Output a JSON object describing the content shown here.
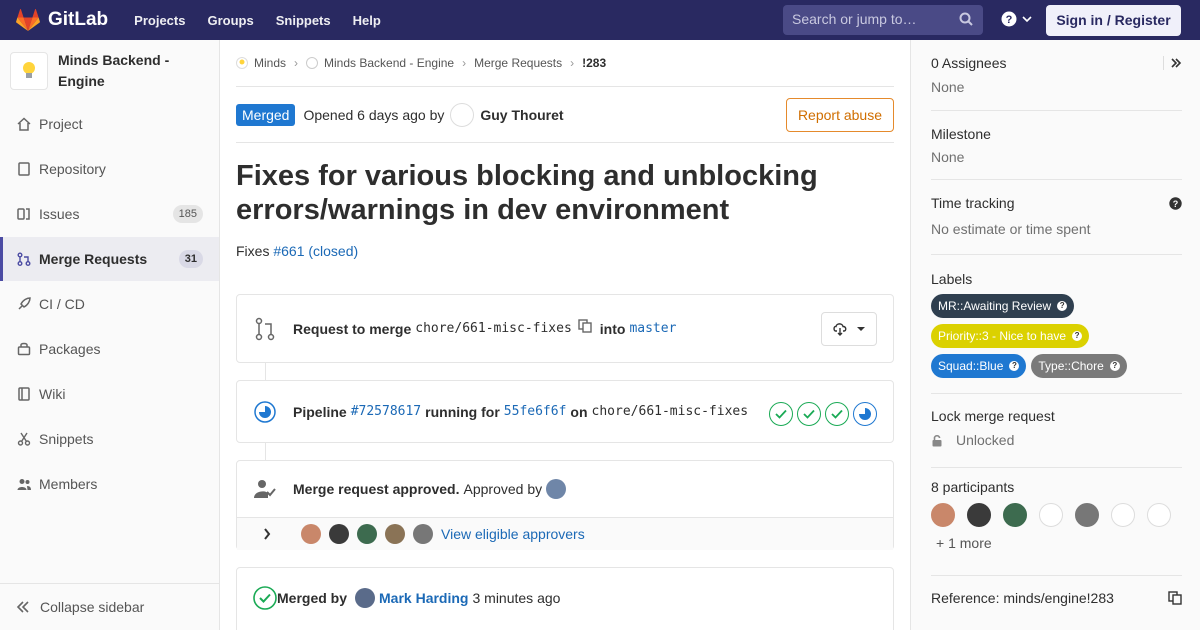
{
  "navbar": {
    "brand": "GitLab",
    "links": [
      "Projects",
      "Groups",
      "Snippets",
      "Help"
    ],
    "search_placeholder": "Search or jump to…",
    "signin_label": "Sign in / Register"
  },
  "sidebar": {
    "project_name": "Minds Backend - Engine",
    "items": [
      {
        "label": "Project",
        "icon": "home-icon"
      },
      {
        "label": "Repository",
        "icon": "doc-icon"
      },
      {
        "label": "Issues",
        "icon": "issues-icon",
        "count": "185"
      },
      {
        "label": "Merge Requests",
        "icon": "merge-request-icon",
        "count": "31",
        "active": true
      },
      {
        "label": "CI / CD",
        "icon": "rocket-icon"
      },
      {
        "label": "Packages",
        "icon": "package-icon"
      },
      {
        "label": "Wiki",
        "icon": "book-icon"
      },
      {
        "label": "Snippets",
        "icon": "scissors-icon"
      },
      {
        "label": "Members",
        "icon": "users-icon"
      }
    ],
    "collapse_label": "Collapse sidebar"
  },
  "breadcrumb": [
    "Minds",
    "Minds Backend - Engine",
    "Merge Requests",
    "!283"
  ],
  "header": {
    "status": "Merged",
    "opened_text": "Opened 6 days ago by",
    "author": "Guy Thouret",
    "report_label": "Report abuse"
  },
  "mr": {
    "title": "Fixes for various blocking and unblocking errors/warnings in dev environment",
    "desc_prefix": "Fixes",
    "desc_link": "#661 (closed)"
  },
  "widget": {
    "request_label": "Request to merge",
    "source_branch": "chore/661-misc-fixes",
    "into_label": "into",
    "target_branch": "master",
    "pipeline_label": "Pipeline",
    "pipeline_id": "#72578617",
    "running_for": "running for",
    "commit": "55fe6f6f",
    "on_label": "on",
    "pipeline_branch": "chore/661-misc-fixes",
    "approved_label": "Merge request approved.",
    "approved_by": "Approved by",
    "view_approvers": "View eligible approvers",
    "merged_by_label": "Merged by",
    "merger": "Mark Harding",
    "merged_time": "3 minutes ago"
  },
  "right_sidebar": {
    "assignees_title": "0 Assignees",
    "assignees_value": "None",
    "milestone_title": "Milestone",
    "milestone_value": "None",
    "time_title": "Time tracking",
    "time_value": "No estimate or time spent",
    "labels_title": "Labels",
    "labels": [
      {
        "text": "MR::Awaiting Review",
        "color": "#2f3f4f"
      },
      {
        "text": "Priority::3 - Nice to have",
        "color": "#dbd100"
      },
      {
        "text": "Squad::Blue",
        "color": "#1f78d1"
      },
      {
        "text": "Type::Chore",
        "color": "#7a7a7a"
      }
    ],
    "lock_title": "Lock merge request",
    "lock_value": "Unlocked",
    "participants_title": "8 participants",
    "more_label": "+ 1 more",
    "reference": "Reference: minds/engine!283"
  },
  "colors": {
    "navbar": "#292961",
    "merged": "#1f78d1",
    "success": "#1aaa55"
  }
}
